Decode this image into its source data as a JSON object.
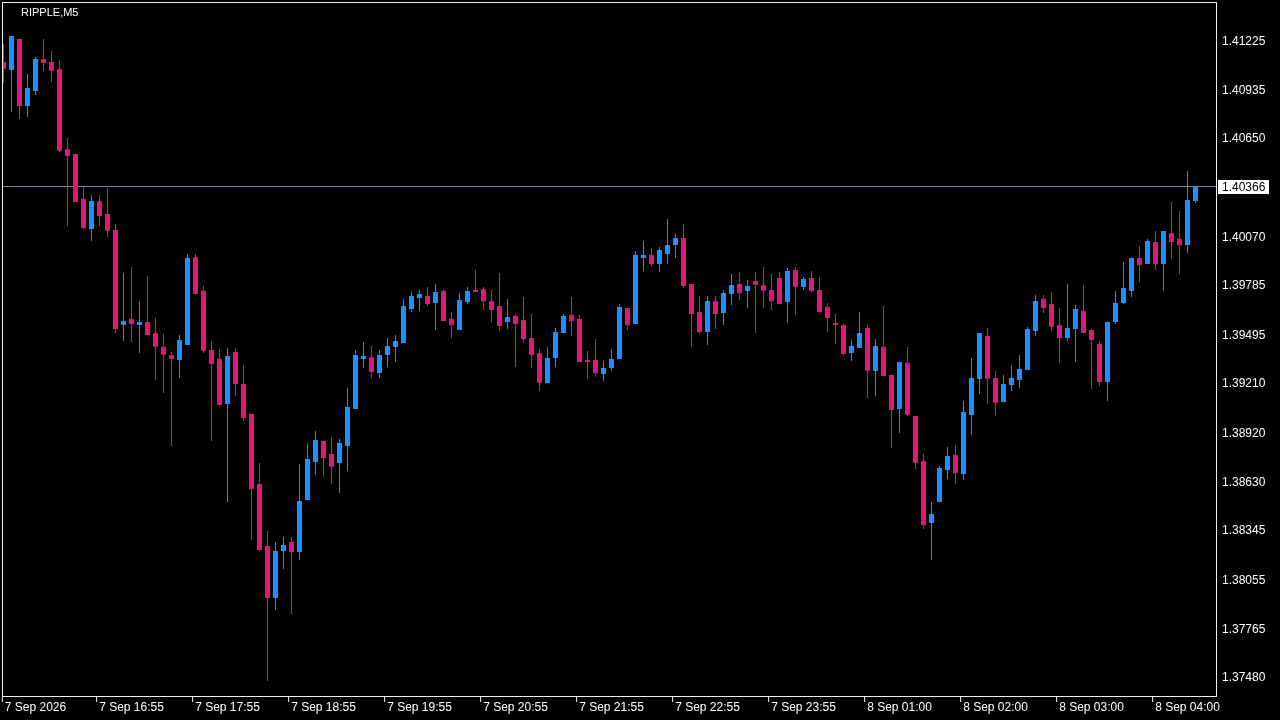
{
  "chart": {
    "chart_data": {
      "type": "candlestick",
      "title": "RIPPLE,M5",
      "categories": [
        null,
        null,
        null,
        null,
        "7 Sep 2026",
        null,
        null,
        null,
        null,
        null,
        null,
        null,
        null,
        null,
        null,
        null,
        "7 Sep 16:55",
        null,
        null,
        null,
        null,
        null,
        null,
        null,
        null,
        null,
        null,
        null,
        "7 Sep 17:55",
        null,
        null,
        null,
        null,
        null,
        null,
        null,
        null,
        null,
        null,
        null,
        "7 Sep 18:55",
        null,
        null,
        null,
        null,
        null,
        null,
        null,
        null,
        null,
        null,
        null,
        "7 Sep 19:55",
        null,
        null,
        null,
        null,
        null,
        null,
        null,
        null,
        null,
        null,
        null,
        "7 Sep 20:55",
        null,
        null,
        null,
        null,
        null,
        null,
        null,
        null,
        null,
        null,
        null,
        "7 Sep 21:55",
        null,
        null,
        null,
        null,
        null,
        null,
        null,
        null,
        null,
        null,
        null,
        "7 Sep 22:55",
        null,
        null,
        null,
        null,
        null,
        null,
        null,
        null,
        null,
        null,
        null,
        "7 Sep 23:55",
        null,
        null,
        null,
        null,
        null,
        null,
        null,
        null,
        null,
        null,
        null,
        "8 Sep 01:00",
        null,
        null,
        null,
        null,
        null,
        null,
        null,
        null,
        null,
        null,
        null,
        "8 Sep 02:00",
        null,
        null,
        null,
        null,
        null,
        null,
        null,
        null,
        null,
        null,
        null,
        "8 Sep 03:00",
        null,
        null,
        null,
        null,
        null,
        null,
        null,
        null,
        null,
        null,
        null,
        "8 Sep 04:00",
        null
      ],
      "ohlc": [
        [
          1.41099,
          1.41204,
          1.40981,
          1.41063
        ],
        [
          1.41057,
          1.41251,
          1.4081,
          1.41251
        ],
        [
          1.41234,
          1.41234,
          1.40769,
          1.40846
        ],
        [
          1.40846,
          1.41028,
          1.40781,
          1.40946
        ],
        [
          1.40934,
          1.41128,
          1.4091,
          1.41116
        ],
        [
          1.41116,
          1.41234,
          1.41052,
          1.41099
        ],
        [
          1.41099,
          1.41163,
          1.40987,
          1.41052
        ],
        [
          1.41057,
          1.4111,
          1.40575,
          1.40581
        ],
        [
          1.40587,
          1.40652,
          1.4014,
          1.40552
        ],
        [
          1.40558,
          1.40558,
          1.40281,
          1.40281
        ],
        [
          1.40293,
          1.40364,
          1.40122,
          1.40128
        ],
        [
          1.40122,
          1.40317,
          1.40052,
          1.40281
        ],
        [
          1.40281,
          1.40317,
          1.4014,
          1.40199
        ],
        [
          1.40205,
          1.40358,
          1.40075,
          1.40111
        ],
        [
          1.40111,
          1.40146,
          1.39511,
          1.39535
        ],
        [
          1.39558,
          1.39858,
          1.39464,
          1.39576
        ],
        [
          1.39587,
          1.39893,
          1.39458,
          1.39564
        ],
        [
          1.39558,
          1.39693,
          1.39393,
          1.3957
        ],
        [
          1.3957,
          1.3984,
          1.39499,
          1.39499
        ],
        [
          1.39505,
          1.39593,
          1.39235,
          1.39429
        ],
        [
          1.39423,
          1.39499,
          1.39158,
          1.39382
        ],
        [
          1.39376,
          1.39393,
          1.38847,
          1.39358
        ],
        [
          1.39352,
          1.39493,
          1.39246,
          1.39464
        ],
        [
          1.3944,
          1.3997,
          1.3944,
          1.39946
        ],
        [
          1.39952,
          1.3997,
          1.3974,
          1.3974
        ],
        [
          1.39752,
          1.39781,
          1.39393,
          1.39405
        ],
        [
          1.39405,
          1.39458,
          1.38876,
          1.39329
        ],
        [
          1.39352,
          1.39411,
          1.39088,
          1.39088
        ],
        [
          1.39093,
          1.39417,
          1.38517,
          1.3937
        ],
        [
          1.39393,
          1.39417,
          1.39141,
          1.39211
        ],
        [
          1.39205,
          1.39317,
          1.38994,
          1.39011
        ],
        [
          1.39029,
          1.39029,
          1.38294,
          1.38594
        ],
        [
          1.38617,
          1.38741,
          1.38229,
          1.38235
        ],
        [
          1.38253,
          1.38341,
          1.37465,
          1.37953
        ],
        [
          1.37953,
          1.38276,
          1.37882,
          1.38223
        ],
        [
          1.38229,
          1.38306,
          1.38123,
          1.38259
        ],
        [
          1.38276,
          1.38306,
          1.37859,
          1.38223
        ],
        [
          1.38223,
          1.38735,
          1.38176,
          1.38517
        ],
        [
          1.38529,
          1.38852,
          1.38529,
          1.38764
        ],
        [
          1.38752,
          1.38929,
          1.38676,
          1.38876
        ],
        [
          1.3887,
          1.3887,
          1.38664,
          1.38776
        ],
        [
          1.38794,
          1.38894,
          1.38623,
          1.38723
        ],
        [
          1.38747,
          1.38882,
          1.3857,
          1.38858
        ],
        [
          1.38847,
          1.39182,
          1.387,
          1.3907
        ],
        [
          1.39064,
          1.39405,
          1.39064,
          1.39376
        ],
        [
          1.39358,
          1.39452,
          1.39305,
          1.3937
        ],
        [
          1.39364,
          1.39429,
          1.39246,
          1.39282
        ],
        [
          1.39276,
          1.39405,
          1.39246,
          1.39376
        ],
        [
          1.39382,
          1.39476,
          1.39311,
          1.39429
        ],
        [
          1.39429,
          1.39493,
          1.3934,
          1.39458
        ],
        [
          1.39452,
          1.39705,
          1.39452,
          1.39664
        ],
        [
          1.39652,
          1.39746,
          1.39634,
          1.39723
        ],
        [
          1.39717,
          1.39758,
          1.3964,
          1.39734
        ],
        [
          1.39723,
          1.39776,
          1.3967,
          1.39681
        ],
        [
          1.39687,
          1.39793,
          1.39529,
          1.39746
        ],
        [
          1.39752,
          1.39758,
          1.39582,
          1.39582
        ],
        [
          1.39587,
          1.39629,
          1.39482,
          1.39558
        ],
        [
          1.39529,
          1.3974,
          1.39529,
          1.39699
        ],
        [
          1.39693,
          1.39776,
          1.39681,
          1.39752
        ],
        [
          1.39758,
          1.39876,
          1.39752,
          1.39752
        ],
        [
          1.39764,
          1.39776,
          1.39646,
          1.39699
        ],
        [
          1.39693,
          1.39758,
          1.39576,
          1.39646
        ],
        [
          1.39664,
          1.39858,
          1.39523,
          1.39552
        ],
        [
          1.39576,
          1.39705,
          1.39534,
          1.39599
        ],
        [
          1.39605,
          1.39617,
          1.39311,
          1.39564
        ],
        [
          1.39582,
          1.39717,
          1.39452,
          1.39476
        ],
        [
          1.39476,
          1.39617,
          1.39305,
          1.39382
        ],
        [
          1.39387,
          1.39411,
          1.3917,
          1.39217
        ],
        [
          1.39217,
          1.39423,
          1.39217,
          1.39358
        ],
        [
          1.39364,
          1.39534,
          1.39311,
          1.39511
        ],
        [
          1.39511,
          1.39617,
          1.39511,
          1.39605
        ],
        [
          1.39611,
          1.39717,
          1.39493,
          1.39582
        ],
        [
          1.39587,
          1.39611,
          1.3934,
          1.3934
        ],
        [
          1.39346,
          1.39399,
          1.3924,
          1.3934
        ],
        [
          1.39346,
          1.3947,
          1.39252,
          1.39276
        ],
        [
          1.3927,
          1.3934,
          1.39229,
          1.39299
        ],
        [
          1.39305,
          1.39411,
          1.39288,
          1.39352
        ],
        [
          1.39358,
          1.39676,
          1.39358,
          1.39658
        ],
        [
          1.39652,
          1.39652,
          1.39529,
          1.39558
        ],
        [
          1.39564,
          1.39987,
          1.39564,
          1.39964
        ],
        [
          1.39952,
          1.40046,
          1.39876,
          1.39964
        ],
        [
          1.39964,
          1.40005,
          1.39905,
          1.39917
        ],
        [
          1.39917,
          1.40011,
          1.3987,
          1.39993
        ],
        [
          1.39975,
          1.40175,
          1.39917,
          1.40023
        ],
        [
          1.40028,
          1.40087,
          1.39952,
          1.40064
        ],
        [
          1.40064,
          1.40146,
          1.39776,
          1.39787
        ],
        [
          1.39793,
          1.39793,
          1.39429,
          1.39623
        ],
        [
          1.39629,
          1.39723,
          1.39505,
          1.39517
        ],
        [
          1.39517,
          1.39723,
          1.3944,
          1.39693
        ],
        [
          1.39693,
          1.39723,
          1.39534,
          1.39623
        ],
        [
          1.39629,
          1.39758,
          1.39558,
          1.3974
        ],
        [
          1.3974,
          1.39852,
          1.39676,
          1.39787
        ],
        [
          1.39793,
          1.39858,
          1.39705,
          1.39746
        ],
        [
          1.39758,
          1.39817,
          1.39658,
          1.39781
        ],
        [
          1.39811,
          1.39864,
          1.39511,
          1.39793
        ],
        [
          1.39787,
          1.39893,
          1.39658,
          1.39758
        ],
        [
          1.39758,
          1.39852,
          1.39646,
          1.39699
        ],
        [
          1.39828,
          1.39864,
          1.39681,
          1.39681
        ],
        [
          1.39693,
          1.39887,
          1.3957,
          1.3987
        ],
        [
          1.39876,
          1.39893,
          1.39617,
          1.39781
        ],
        [
          1.39781,
          1.39834,
          1.39764,
          1.39823
        ],
        [
          1.39828,
          1.3987,
          1.39752,
          1.39758
        ],
        [
          1.39758,
          1.39834,
          1.39634,
          1.39634
        ],
        [
          1.39658,
          1.39681,
          1.39517,
          1.39599
        ],
        [
          1.39564,
          1.39617,
          1.39446,
          1.39558
        ],
        [
          1.39552,
          1.39558,
          1.39382,
          1.39387
        ],
        [
          1.39393,
          1.39464,
          1.39346,
          1.39429
        ],
        [
          1.39423,
          1.39629,
          1.39423,
          1.39505
        ],
        [
          1.39534,
          1.39558,
          1.39129,
          1.39288
        ],
        [
          1.39288,
          1.3947,
          1.39141,
          1.39429
        ],
        [
          1.39423,
          1.39664,
          1.39258,
          1.39258
        ],
        [
          1.39258,
          1.39258,
          1.38835,
          1.39058
        ],
        [
          1.39064,
          1.39335,
          1.38923,
          1.39335
        ],
        [
          1.39329,
          1.39423,
          1.39023,
          1.39029
        ],
        [
          1.39017,
          1.39017,
          1.38711,
          1.38747
        ],
        [
          1.38752,
          1.38794,
          1.38358,
          1.38382
        ],
        [
          1.38394,
          1.38511,
          1.38176,
          1.38441
        ],
        [
          1.38517,
          1.38723,
          1.38517,
          1.38711
        ],
        [
          1.38705,
          1.38835,
          1.38652,
          1.38782
        ],
        [
          1.38788,
          1.38847,
          1.38623,
          1.38688
        ],
        [
          1.38682,
          1.39105,
          1.38647,
          1.39041
        ],
        [
          1.39029,
          1.39358,
          1.38911,
          1.3924
        ],
        [
          1.3924,
          1.39505,
          1.39152,
          1.39505
        ],
        [
          1.39487,
          1.39534,
          1.39093,
          1.3924
        ],
        [
          1.3924,
          1.39282,
          1.39029,
          1.39099
        ],
        [
          1.39105,
          1.39258,
          1.39105,
          1.39205
        ],
        [
          1.39205,
          1.39317,
          1.3917,
          1.3924
        ],
        [
          1.39235,
          1.39376,
          1.39188,
          1.39293
        ],
        [
          1.39293,
          1.3954,
          1.39293,
          1.39529
        ],
        [
          1.39523,
          1.39729,
          1.39493,
          1.39693
        ],
        [
          1.39705,
          1.39729,
          1.39629,
          1.39658
        ],
        [
          1.39676,
          1.39746,
          1.39523,
          1.39546
        ],
        [
          1.39552,
          1.39652,
          1.39335,
          1.39482
        ],
        [
          1.39482,
          1.39793,
          1.39464,
          1.39534
        ],
        [
          1.39534,
          1.3967,
          1.3934,
          1.39646
        ],
        [
          1.39634,
          1.39787,
          1.39511,
          1.39511
        ],
        [
          1.39523,
          1.39529,
          1.39182,
          1.3947
        ],
        [
          1.3944,
          1.39458,
          1.39199,
          1.39223
        ],
        [
          1.39223,
          1.3957,
          1.39111,
          1.3957
        ],
        [
          1.39576,
          1.39752,
          1.39564,
          1.39681
        ],
        [
          1.39687,
          1.39923,
          1.39681,
          1.3977
        ],
        [
          1.39758,
          1.39946,
          1.39723,
          1.39946
        ],
        [
          1.39946,
          1.40017,
          1.39811,
          1.39911
        ],
        [
          1.39917,
          1.40058,
          1.39917,
          1.40046
        ],
        [
          1.4004,
          1.40105,
          1.39881,
          1.39917
        ],
        [
          1.39917,
          1.40105,
          1.39758,
          1.40105
        ],
        [
          1.40093,
          1.40275,
          1.39946,
          1.40046
        ],
        [
          1.40058,
          1.40222,
          1.39858,
          1.40028
        ],
        [
          1.40028,
          1.40458,
          1.39981,
          1.40287
        ],
        [
          1.40287,
          1.40366,
          1.40275,
          1.40366
        ]
      ],
      "ylim": [
        1.37377,
        1.41446
      ],
      "yticks": [
        {
          "value": 1.41225,
          "label": "1.41225"
        },
        {
          "value": 1.40935,
          "label": "1.40935"
        },
        {
          "value": 1.4065,
          "label": "1.40650"
        },
        {
          "value": 1.4007,
          "label": "1.40070"
        },
        {
          "value": 1.39785,
          "label": "1.39785"
        },
        {
          "value": 1.39495,
          "label": "1.39495"
        },
        {
          "value": 1.3921,
          "label": "1.39210"
        },
        {
          "value": 1.3892,
          "label": "1.38920"
        },
        {
          "value": 1.3863,
          "label": "1.38630"
        },
        {
          "value": 1.38345,
          "label": "1.38345"
        },
        {
          "value": 1.38055,
          "label": "1.38055"
        },
        {
          "value": 1.37765,
          "label": "1.37765"
        },
        {
          "value": 1.3748,
          "label": "1.37480"
        }
      ],
      "ref_lines": [
        {
          "axis": "y",
          "value": 1.40366,
          "label": "1.40366"
        }
      ]
    }
  }
}
